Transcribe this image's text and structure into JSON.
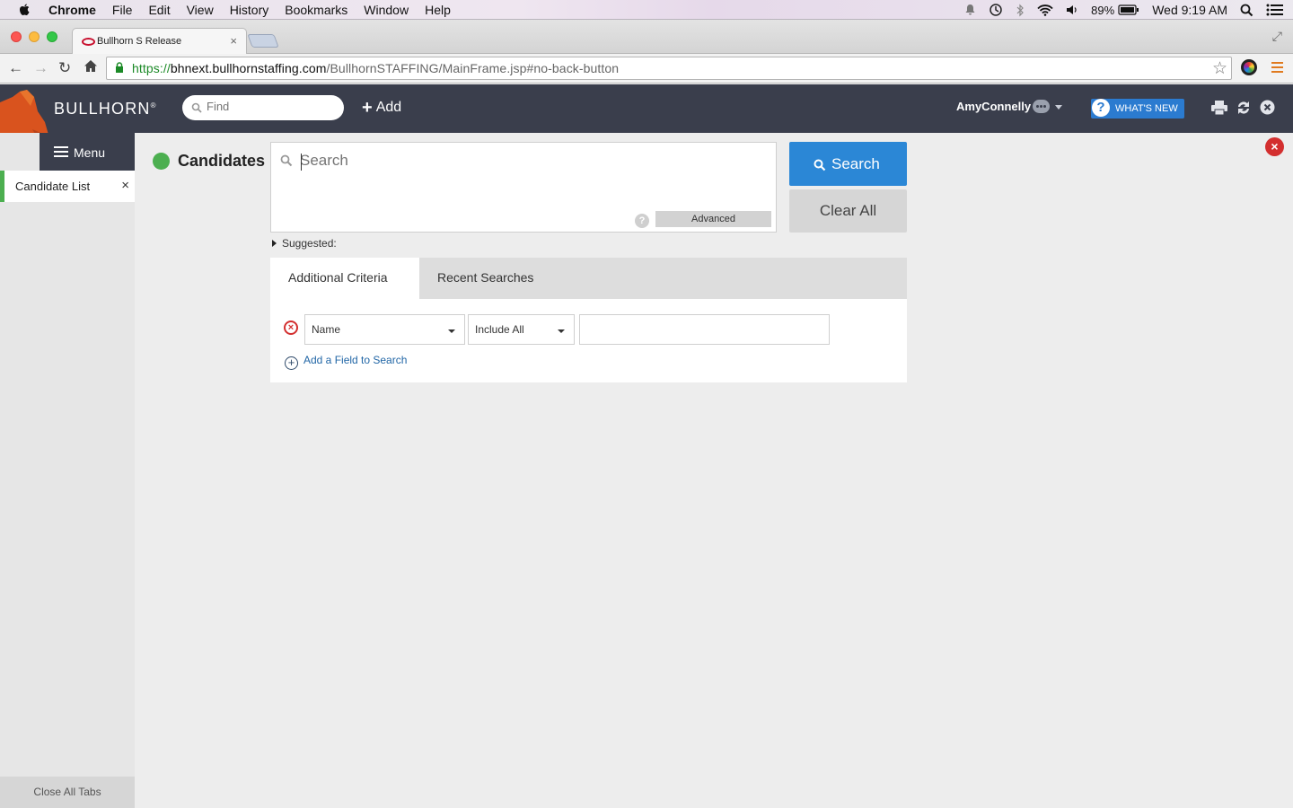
{
  "macos_menubar": {
    "app": "Chrome",
    "items": [
      "File",
      "Edit",
      "View",
      "History",
      "Bookmarks",
      "Window",
      "Help"
    ],
    "battery": "89%",
    "clock": "Wed 9:19 AM"
  },
  "browser": {
    "tab_title": "Bullhorn S Release",
    "url_scheme": "https://",
    "url_host": "bhnext.bullhornstaffing.com",
    "url_path": "/BullhornSTAFFING/MainFrame.jsp#no-back-button"
  },
  "header": {
    "brand": "BULLHORN",
    "brand_mark": "®",
    "find_placeholder": "Find",
    "add_label": "Add",
    "user_name": "AmyConnelly",
    "whats_new_label": "WHAT'S NEW"
  },
  "sidebar": {
    "menu_label": "Menu",
    "open_tab_label": "Candidate List",
    "close_all_label": "Close All Tabs"
  },
  "main": {
    "entity_title": "Candidates",
    "status_color": "#4caf50",
    "search_placeholder": "Search",
    "help_label": "?",
    "advanced_label": "Advanced",
    "search_button": "Search",
    "clear_button": "Clear All",
    "suggested_label": "Suggested:",
    "tabs": [
      {
        "label": "Additional Criteria",
        "active": true
      },
      {
        "label": "Recent Searches",
        "active": false
      }
    ],
    "criteria": {
      "field_value": "Name",
      "operator_value": "Include All",
      "value": ""
    },
    "add_field_label": "Add a Field to Search"
  },
  "colors": {
    "header_bg": "#3a3e4c",
    "accent_blue": "#2b87d6",
    "close_red": "#d32f2f"
  }
}
